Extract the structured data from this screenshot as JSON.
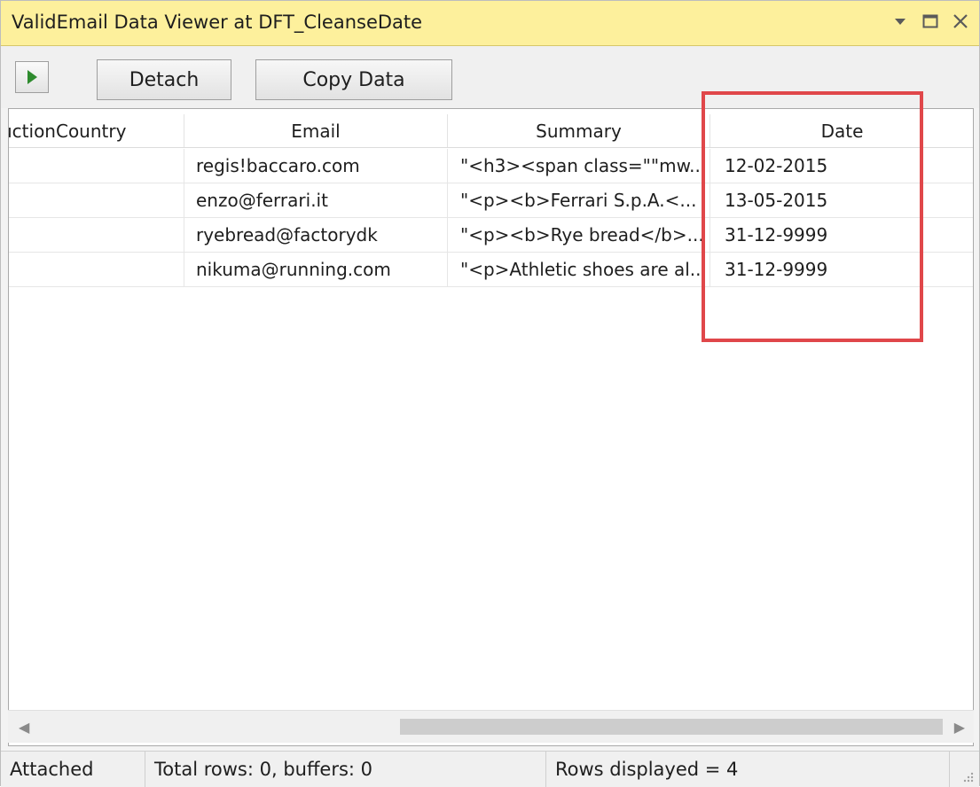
{
  "window": {
    "title": "ValidEmail Data Viewer at DFT_CleanseDate"
  },
  "toolbar": {
    "play_icon": "play-icon",
    "detach_label": "Detach",
    "copy_label": "Copy Data"
  },
  "grid": {
    "columns": [
      "uctionCountry",
      "Email",
      "Summary",
      "Date"
    ],
    "rows": [
      {
        "country": "",
        "email": "regis!baccaro.com",
        "summary": "\"<h3><span class=\"\"mw...",
        "date": "12-02-2015"
      },
      {
        "country": "",
        "email": "enzo@ferrari.it",
        "summary": "\"<p><b>Ferrari S.p.A.<...",
        "date": "13-05-2015"
      },
      {
        "country": "",
        "email": "ryebread@factorydk",
        "summary": "\"<p><b>Rye bread</b>...",
        "date": "31-12-9999"
      },
      {
        "country": "",
        "email": "nikuma@running.com",
        "summary": "\"<p>Athletic shoes are al...",
        "date": "31-12-9999"
      }
    ]
  },
  "status": {
    "state": "Attached",
    "totals": "Total rows: 0, buffers: 0",
    "displayed": "Rows displayed = 4"
  },
  "colors": {
    "titlebar": "#fdf09c",
    "highlight": "#e0474a",
    "play": "#2e8b2e"
  }
}
